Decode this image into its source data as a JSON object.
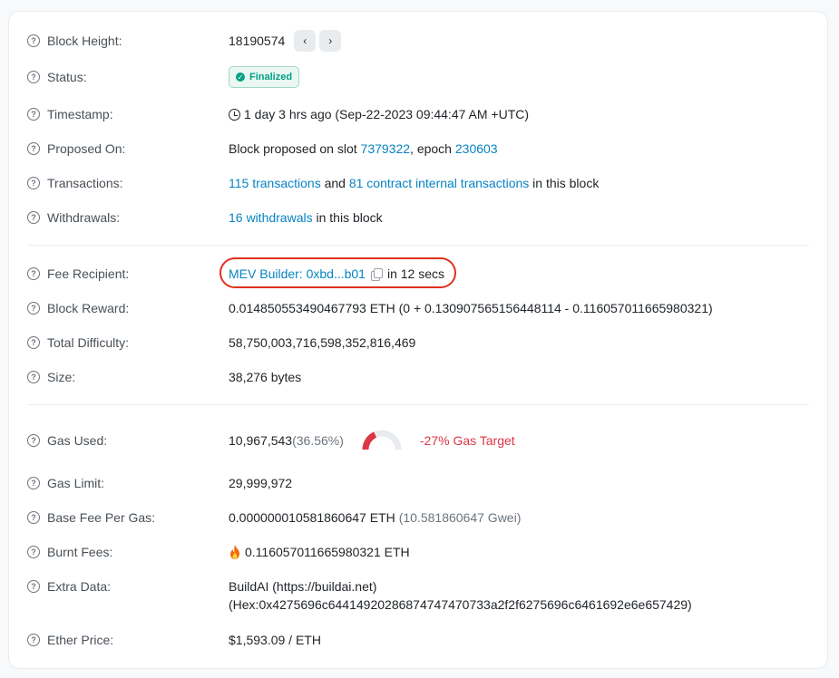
{
  "rows": {
    "block_height": {
      "label": "Block Height:",
      "value": "18190574",
      "prev": "‹",
      "next": "›"
    },
    "status": {
      "label": "Status:",
      "badge": "Finalized"
    },
    "timestamp": {
      "label": "Timestamp:",
      "value": "1 day 3 hrs ago (Sep-22-2023 09:44:47 AM +UTC)"
    },
    "proposed_on": {
      "label": "Proposed On:",
      "prefix": "Block proposed on slot ",
      "slot": "7379322",
      "mid": ", epoch ",
      "epoch": "230603"
    },
    "transactions": {
      "label": "Transactions:",
      "tx_link": "115 transactions",
      "and": " and ",
      "internal_link": "81 contract internal transactions",
      "suffix": " in this block"
    },
    "withdrawals": {
      "label": "Withdrawals:",
      "link": "16 withdrawals",
      "suffix": " in this block"
    },
    "fee_recipient": {
      "label": "Fee Recipient:",
      "link": "MEV Builder: 0xbd...b01",
      "suffix": "in 12 secs"
    },
    "block_reward": {
      "label": "Block Reward:",
      "value": "0.014850553490467793 ETH (0 + 0.130907565156448114 - 0.116057011665980321)"
    },
    "total_difficulty": {
      "label": "Total Difficulty:",
      "value": "58,750,003,716,598,352,816,469"
    },
    "size": {
      "label": "Size:",
      "value": "38,276 bytes"
    },
    "gas_used": {
      "label": "Gas Used:",
      "value": "10,967,543",
      "pct": "(36.56%)",
      "gauge_fraction": 0.3656,
      "target": "-27% Gas Target"
    },
    "gas_limit": {
      "label": "Gas Limit:",
      "value": "29,999,972"
    },
    "base_fee": {
      "label": "Base Fee Per Gas:",
      "value": "0.00000001058186064​7 ETH",
      "gwei": "(10.581860647 Gwei)"
    },
    "burnt_fees": {
      "label": "Burnt Fees:",
      "value": "0.116057011665980321 ETH"
    },
    "extra_data": {
      "label": "Extra Data:",
      "line1": "BuildAI (https://buildai.net)",
      "line2": "(Hex:0x4275696c64414920286874747470733a2f2f6275696c6461692e6e657429)"
    },
    "ether_price": {
      "label": "Ether Price:",
      "value": "$1,593.09 / ETH"
    }
  },
  "colors": {
    "link": "#0784c3",
    "finalized": "#00a186",
    "gas_target": "#dc3545",
    "highlight": "#e0301e"
  },
  "icons": {
    "help": "question-circle-icon",
    "clock": "clock-icon",
    "copy": "copy-icon",
    "fire": "fire-icon",
    "check": "check-circle-icon"
  }
}
